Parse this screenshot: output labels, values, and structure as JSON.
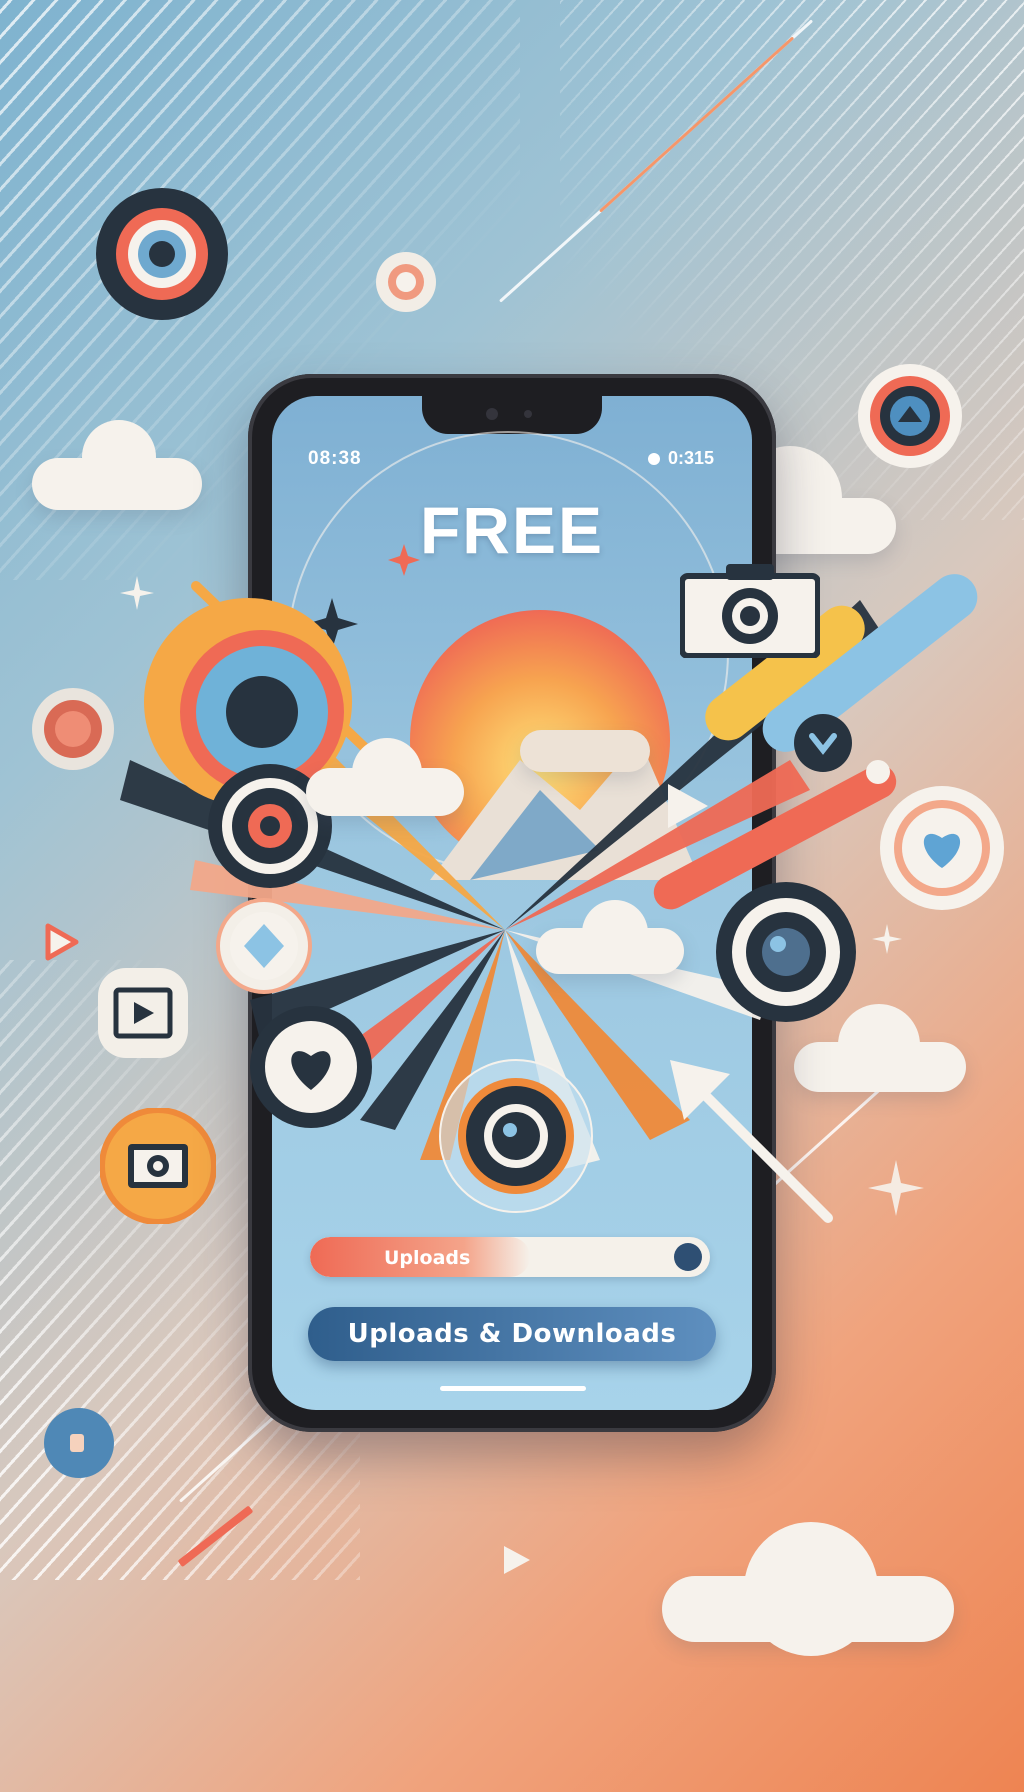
{
  "phone": {
    "status_time": "08:38",
    "status_right": "0:315"
  },
  "hero": {
    "title": "FREE"
  },
  "upload_bar": {
    "label": "Uploads",
    "progress": 0.55
  },
  "cta": {
    "label": "Uploads & Downloads"
  },
  "colors": {
    "accent_orange": "#ef6a55",
    "accent_navy": "#2f5e8c",
    "sky_blue": "#9cc7e0",
    "cloud": "#f6f2ec",
    "dark": "#1e1e22"
  },
  "icons": [
    "lens-icon",
    "camera-icon",
    "heart-icon",
    "play-icon",
    "photo-frame-icon",
    "video-icon",
    "cursor-arrow-icon",
    "diamond-icon",
    "sparkle-icon",
    "cloud-icon"
  ]
}
